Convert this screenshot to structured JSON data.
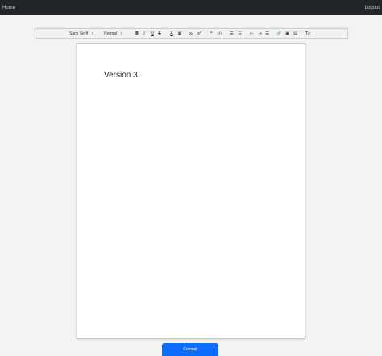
{
  "nav": {
    "home": "Home",
    "logout": "Logout"
  },
  "toolbar": {
    "font": "Sans Serif",
    "size": "Normal",
    "select_arrow": "⇕",
    "bold": "B",
    "italic": "I",
    "underline": "U",
    "strike": "S",
    "color": "A",
    "background": "▦",
    "subscript": "x₂",
    "superscript": "x²",
    "blockquote": "❞",
    "code": "‹/›",
    "ordered_list": "☰",
    "bullet_list": "☷",
    "outdent": "⇤",
    "indent": "⇥",
    "align": "☰",
    "link": "🔗",
    "image": "▣",
    "video": "▤",
    "clean": "Tx"
  },
  "editor": {
    "text": "Version 3"
  },
  "commit_label": "Commit"
}
